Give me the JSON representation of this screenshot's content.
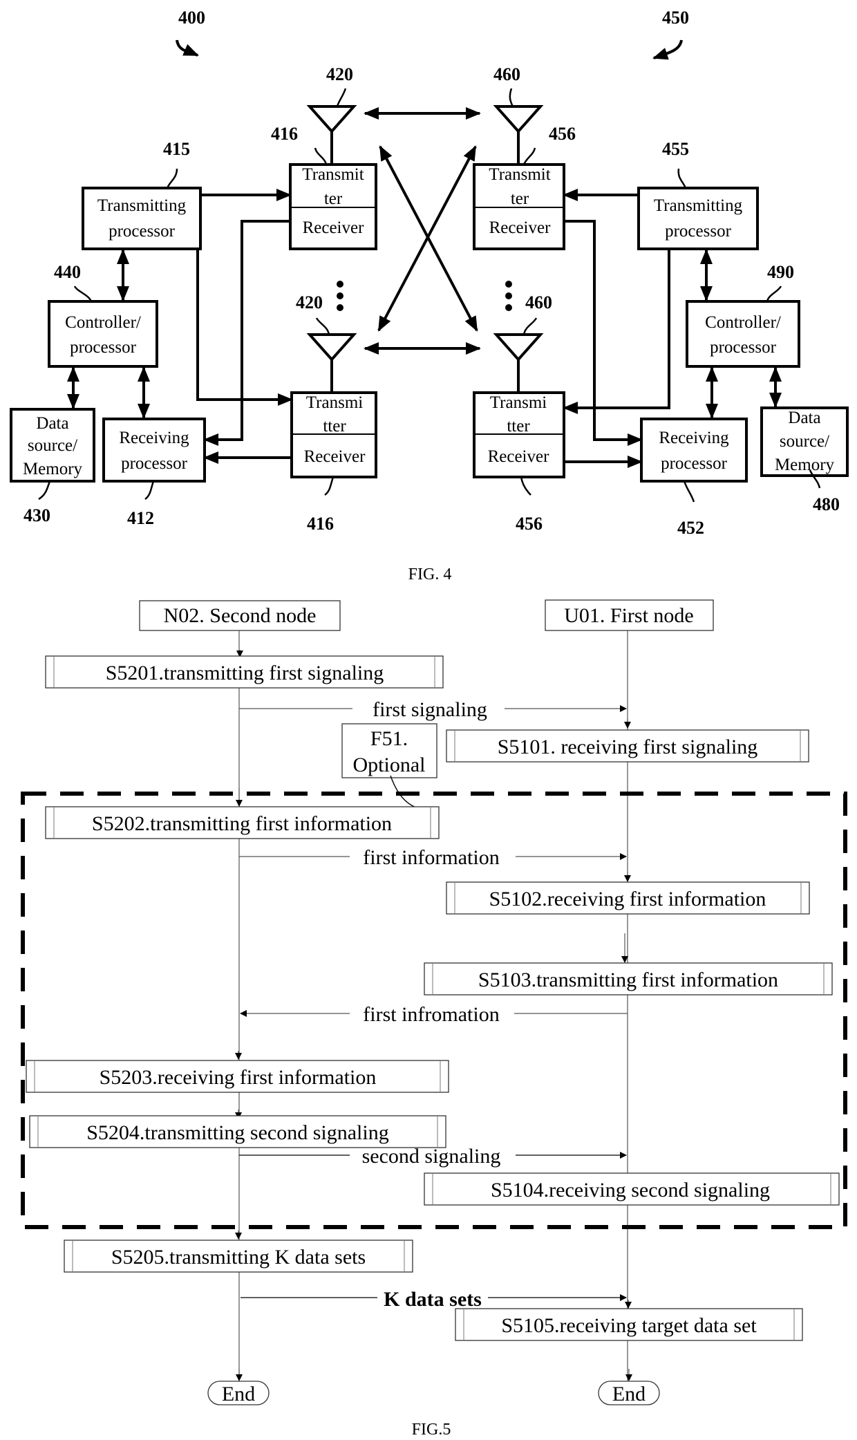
{
  "fig4": {
    "caption": "FIG. 4",
    "refs": {
      "device_left": "400",
      "device_right": "450",
      "antenna_left_top": "420",
      "antenna_left_bottom": "420",
      "antenna_right_top": "460",
      "antenna_right_bottom": "460",
      "transceiver_left_top": "416",
      "transceiver_left_bottom": "416",
      "transceiver_right_top": "456",
      "transceiver_right_bottom": "456",
      "tx_proc_left": "415",
      "tx_proc_right": "455",
      "controller_left": "440",
      "controller_right": "490",
      "memory_left": "430",
      "memory_right": "480",
      "rx_proc_left": "412",
      "rx_proc_right": "452"
    },
    "blocks": {
      "tx_proc": [
        "Transmitting",
        "processor"
      ],
      "controller": [
        "Controller/",
        "processor"
      ],
      "memory": [
        "Data",
        "source/",
        "Memory"
      ],
      "rx_proc": [
        "Receiving",
        "processor"
      ],
      "transmitter_top": [
        "Transmit",
        "ter"
      ],
      "transmitter_bottom": [
        "Transmi",
        "tter"
      ],
      "receiver": "Receiver"
    }
  },
  "fig5": {
    "caption": "FIG.5",
    "nodes": {
      "second": "N02. Second node",
      "first": "U01. First node"
    },
    "optional_note": [
      "F51.",
      "Optional"
    ],
    "steps": {
      "s5201": "S5201.transmitting first signaling",
      "s5101": "S5101. receiving first signaling",
      "s5202": "S5202.transmitting first information",
      "s5102": "S5102.receiving first information",
      "s5103": "S5103.transmitting first information",
      "s5203": "S5203.receiving first information",
      "s5204": "S5204.transmitting second signaling",
      "s5104": "S5104.receiving second signaling",
      "s5205": "S5205.transmitting K data sets",
      "s5105": "S5105.receiving target data set"
    },
    "messages": {
      "m1": "first signaling",
      "m2": "first information",
      "m3": "first infromation",
      "m4": "second signaling",
      "m5": "K data sets"
    },
    "end_left": "End",
    "end_right": "End"
  }
}
